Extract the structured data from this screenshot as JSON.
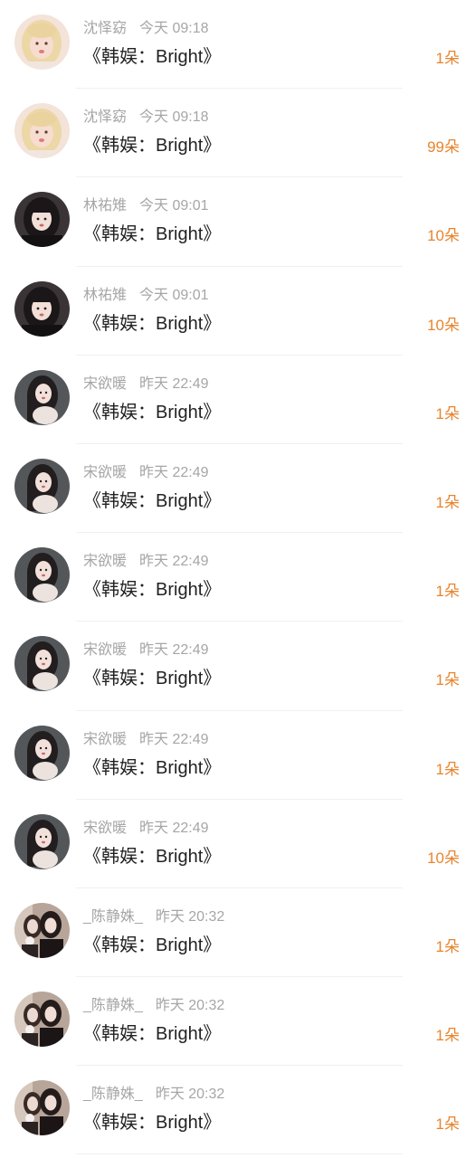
{
  "accent_color": "#e8842c",
  "records": [
    {
      "user": "沈怿窈",
      "time": "今天 09:18",
      "title": "《韩娱：Bright》",
      "gift": "1朵",
      "avatar": "blonde-girl"
    },
    {
      "user": "沈怿窈",
      "time": "今天 09:18",
      "title": "《韩娱：Bright》",
      "gift": "99朵",
      "avatar": "blonde-girl"
    },
    {
      "user": "林祐雉",
      "time": "今天 09:01",
      "title": "《韩娱：Bright》",
      "gift": "10朵",
      "avatar": "dark-hair-girl"
    },
    {
      "user": "林祐雉",
      "time": "今天 09:01",
      "title": "《韩娱：Bright》",
      "gift": "10朵",
      "avatar": "dark-hair-girl"
    },
    {
      "user": "宋欲暖",
      "time": "昨天 22:49",
      "title": "《韩娱：Bright》",
      "gift": "1朵",
      "avatar": "long-hair-girl"
    },
    {
      "user": "宋欲暖",
      "time": "昨天 22:49",
      "title": "《韩娱：Bright》",
      "gift": "1朵",
      "avatar": "long-hair-girl"
    },
    {
      "user": "宋欲暖",
      "time": "昨天 22:49",
      "title": "《韩娱：Bright》",
      "gift": "1朵",
      "avatar": "long-hair-girl"
    },
    {
      "user": "宋欲暖",
      "time": "昨天 22:49",
      "title": "《韩娱：Bright》",
      "gift": "1朵",
      "avatar": "long-hair-girl"
    },
    {
      "user": "宋欲暖",
      "time": "昨天 22:49",
      "title": "《韩娱：Bright》",
      "gift": "1朵",
      "avatar": "long-hair-girl"
    },
    {
      "user": "宋欲暖",
      "time": "昨天 22:49",
      "title": "《韩娱：Bright》",
      "gift": "10朵",
      "avatar": "long-hair-girl"
    },
    {
      "user": "_陈静姝_",
      "time": "昨天 20:32",
      "title": "《韩娱：Bright》",
      "gift": "1朵",
      "avatar": "two-girls"
    },
    {
      "user": "_陈静姝_",
      "time": "昨天 20:32",
      "title": "《韩娱：Bright》",
      "gift": "1朵",
      "avatar": "two-girls"
    },
    {
      "user": "_陈静姝_",
      "time": "昨天 20:32",
      "title": "《韩娱：Bright》",
      "gift": "1朵",
      "avatar": "two-girls"
    }
  ]
}
